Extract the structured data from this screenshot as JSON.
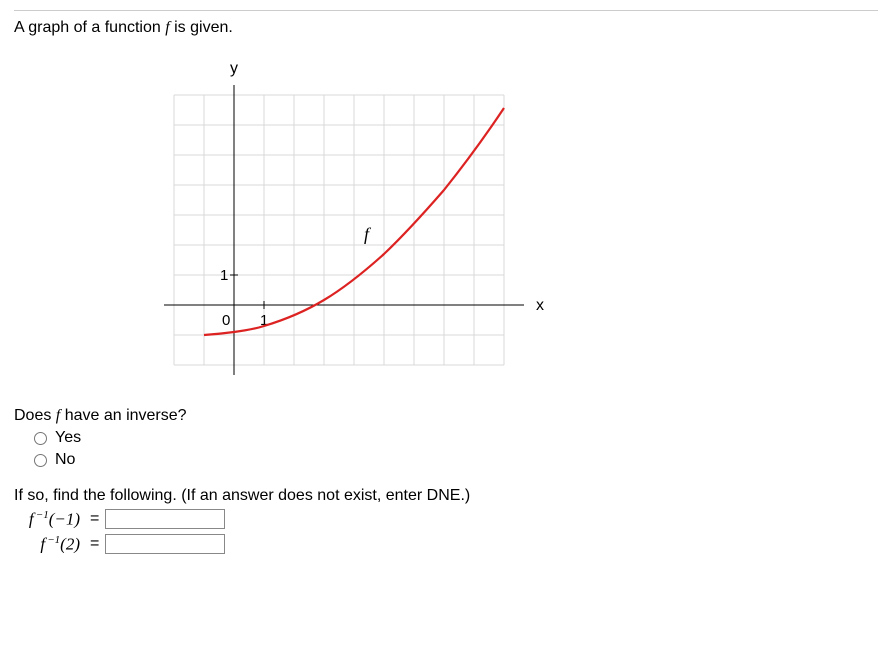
{
  "prompt": {
    "prefix": "A graph of a function ",
    "f": "f",
    "suffix": " is given."
  },
  "graph": {
    "y_label": "y",
    "x_label": "x",
    "f_label": "f",
    "origin_label": "0",
    "tick_x_label": "1",
    "tick_y_label": "1"
  },
  "inverse_question": {
    "prefix": "Does ",
    "f": "f",
    "suffix": " have an inverse?",
    "option_yes": "Yes",
    "option_no": "No"
  },
  "followup": {
    "text": "If so, find the following. (If an answer does not exist, enter DNE.)",
    "rows": [
      {
        "label_html": "f<sup> −1</sup>(−1)",
        "eq": "="
      },
      {
        "label_html": "f<sup> −1</sup>(2)",
        "eq": "="
      }
    ]
  },
  "chart_data": {
    "type": "line",
    "title": "",
    "xlabel": "x",
    "ylabel": "y",
    "xlim": [
      -2,
      10
    ],
    "ylim": [
      -3,
      8
    ],
    "series": [
      {
        "name": "f",
        "x": [
          -1,
          0,
          1,
          2,
          3,
          4,
          5,
          6,
          7,
          8,
          9
        ],
        "y": [
          -1,
          -0.9,
          -0.7,
          -0.4,
          0.1,
          0.8,
          1.7,
          2.8,
          4.1,
          5.6,
          7.3
        ]
      }
    ],
    "tick_x": [
      1
    ],
    "tick_y": [
      1
    ],
    "grid": true
  }
}
